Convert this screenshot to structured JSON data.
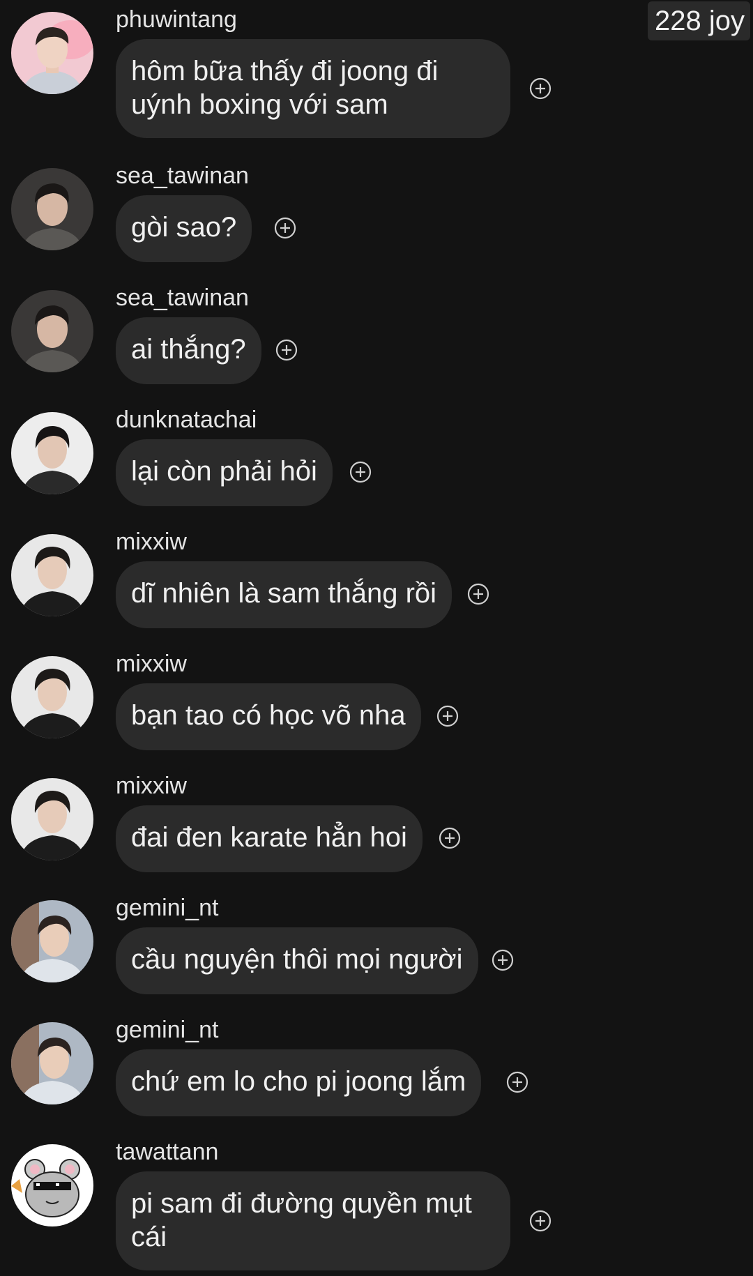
{
  "watermark": "228 joy",
  "messages": [
    {
      "username": "phuwintang",
      "text": "hôm bữa thấy đi joong đi uýnh boxing với sam",
      "avatar_icon": "person-avatar-icon"
    },
    {
      "username": "sea_tawinan",
      "text": "gòi sao?",
      "avatar_icon": "person-avatar-icon"
    },
    {
      "username": "sea_tawinan",
      "text": "ai thắng?",
      "avatar_icon": "person-avatar-icon"
    },
    {
      "username": "dunknatachai",
      "text": "lại còn phải hỏi",
      "avatar_icon": "person-avatar-icon"
    },
    {
      "username": "mixxiw",
      "text": "dĩ nhiên là sam thắng rồi",
      "avatar_icon": "person-avatar-icon"
    },
    {
      "username": "mixxiw",
      "text": "bạn tao có học võ nha",
      "avatar_icon": "person-avatar-icon"
    },
    {
      "username": "mixxiw",
      "text": "đai đen karate hẳn hoi",
      "avatar_icon": "person-avatar-icon"
    },
    {
      "username": "gemini_nt",
      "text": "cầu nguyện thôi mọi người",
      "avatar_icon": "person-avatar-icon"
    },
    {
      "username": "gemini_nt",
      "text": "chứ em lo cho pi joong lắm",
      "avatar_icon": "person-avatar-icon"
    },
    {
      "username": "tawattann",
      "text": "pi sam đi đường quyền mụt cái",
      "avatar_icon": "chinchilla-sunglasses-avatar-icon"
    }
  ],
  "icons": {
    "add": "add-reaction-icon"
  },
  "colors": {
    "background": "#131313",
    "bubble": "#2b2b2b",
    "text": "#f0f0f0"
  }
}
